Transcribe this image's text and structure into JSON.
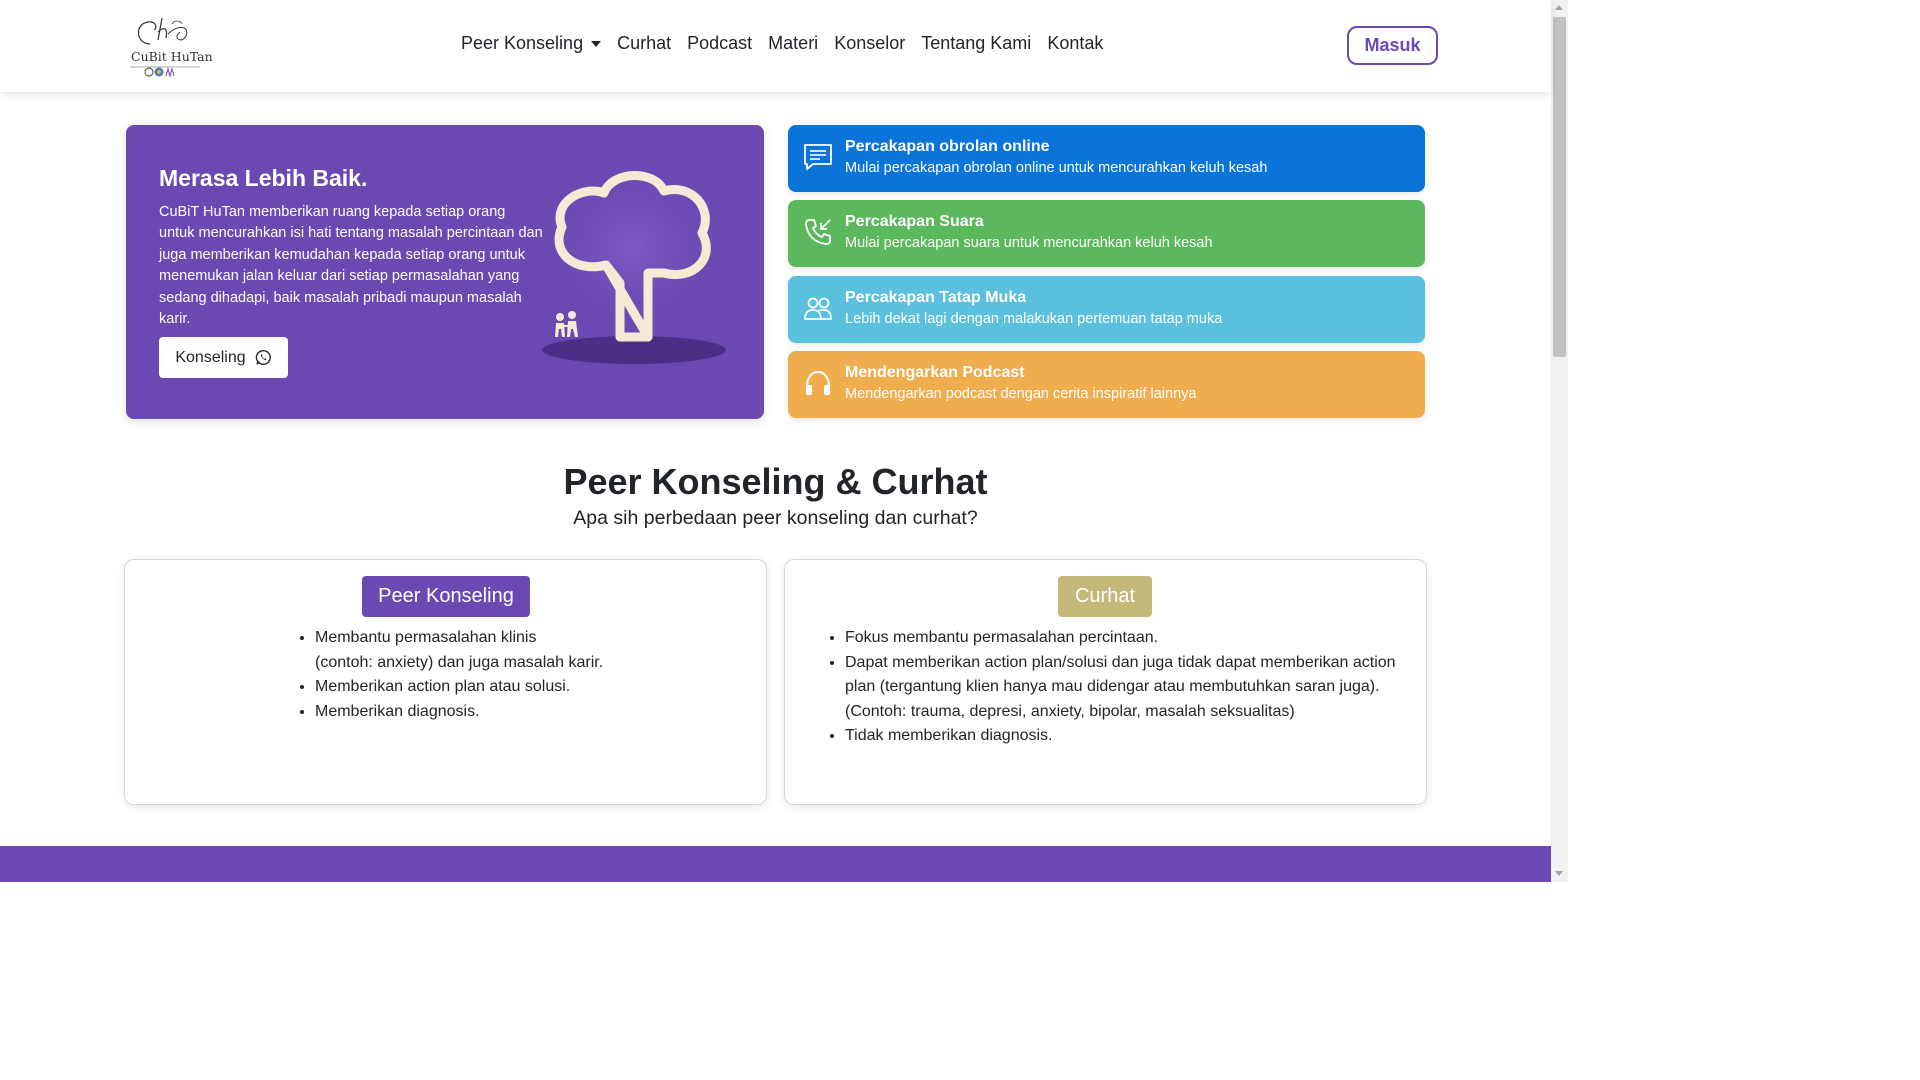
{
  "logo": {
    "text": "CuBit HuTan"
  },
  "nav": {
    "items": [
      {
        "label": "Peer Konseling",
        "dropdown": true
      },
      {
        "label": "Curhat"
      },
      {
        "label": "Podcast"
      },
      {
        "label": "Materi"
      },
      {
        "label": "Konselor"
      },
      {
        "label": "Tentang Kami"
      },
      {
        "label": "Kontak"
      }
    ],
    "login_label": "Masuk"
  },
  "hero": {
    "title": "Merasa Lebih Baik.",
    "description": "CuBiT HuTan memberikan ruang kepada setiap orang untuk mencurahkan isi hati tentang masalah percintaan dan juga memberikan kemudahan kepada setiap orang untuk menemukan jalan keluar dari setiap permasalahan yang sedang dihadapi, baik masalah pribadi maupun masalah karir.",
    "button_label": "Konseling",
    "button_icon": "whatsapp-icon"
  },
  "actions": [
    {
      "title": "Percakapan obrolan online",
      "subtitle": "Mulai percakapan obrolan online untuk mencurahkan keluh kesah",
      "icon": "chat-icon",
      "color": "#0a74d9"
    },
    {
      "title": "Percakapan Suara",
      "subtitle": "Mulai percakapan suara untuk mencurahkan keluh kesah",
      "icon": "phone-incoming-icon",
      "color": "#5cb85c"
    },
    {
      "title": "Percakapan Tatap Muka",
      "subtitle": "Lebih dekat lagi dengan malakukan pertemuan tatap muka",
      "icon": "people-icon",
      "color": "#5bc0de"
    },
    {
      "title": "Mendengarkan Podcast",
      "subtitle": "Mendengarkan podcast dengan cerita inspiratif lainnya",
      "icon": "headphones-icon",
      "color": "#f0ad4e"
    }
  ],
  "section": {
    "title": "Peer Konseling & Curhat",
    "subtitle": "Apa sih perbedaan peer konseling dan curhat?"
  },
  "compare": {
    "left": {
      "badge": "Peer Konseling",
      "items": [
        [
          "Membantu permasalahan klinis",
          "(contoh: anxiety) dan juga masalah karir."
        ],
        [
          "Memberikan action plan atau solusi."
        ],
        [
          "Memberikan diagnosis."
        ]
      ]
    },
    "right": {
      "badge": "Curhat",
      "items": [
        [
          "Fokus membantu permasalahan percintaan."
        ],
        [
          "Dapat memberikan action plan/solusi dan juga tidak dapat memberikan action plan (tergantung klien hanya mau didengar atau membutuhkan saran juga).",
          "(Contoh: trauma, depresi, anxiety, bipolar, masalah seksualitas)"
        ],
        [
          "Tidak memberikan diagnosis."
        ]
      ]
    }
  },
  "colors": {
    "brand_purple": "#6b49b3",
    "gold": "#c5b87a",
    "blue": "#0a74d9",
    "green": "#5cb85c",
    "cyan": "#5bc0de",
    "orange": "#f0ad4e"
  }
}
